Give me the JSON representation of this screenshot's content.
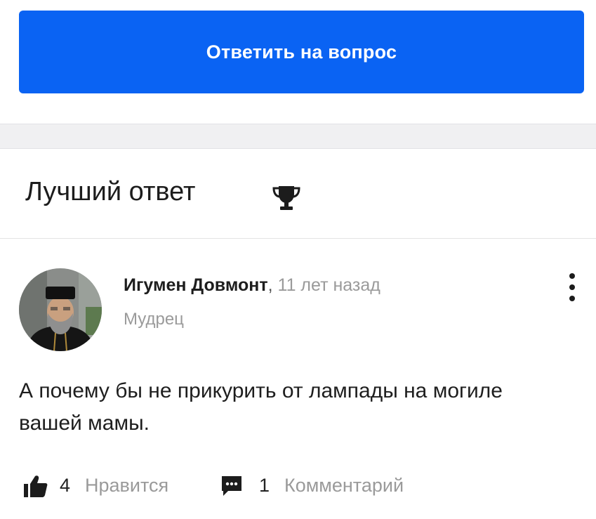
{
  "question": {
    "answer_button_label": "Ответить на вопрос"
  },
  "best_answer": {
    "heading": "Лучший ответ",
    "icon": "trophy-icon",
    "author": {
      "name": "Игумен Довмонт",
      "separator": ",",
      "time": "11 лет назад",
      "rank": "Мудрец"
    },
    "text": "А почему бы не прикурить от лампады на могиле вашей мамы.",
    "likes": {
      "count": "4",
      "label": "Нравится"
    },
    "comments": {
      "count": "1",
      "label": "Комментарий"
    }
  },
  "colors": {
    "accent": "#0a63f3",
    "muted": "#9a9a9a"
  }
}
